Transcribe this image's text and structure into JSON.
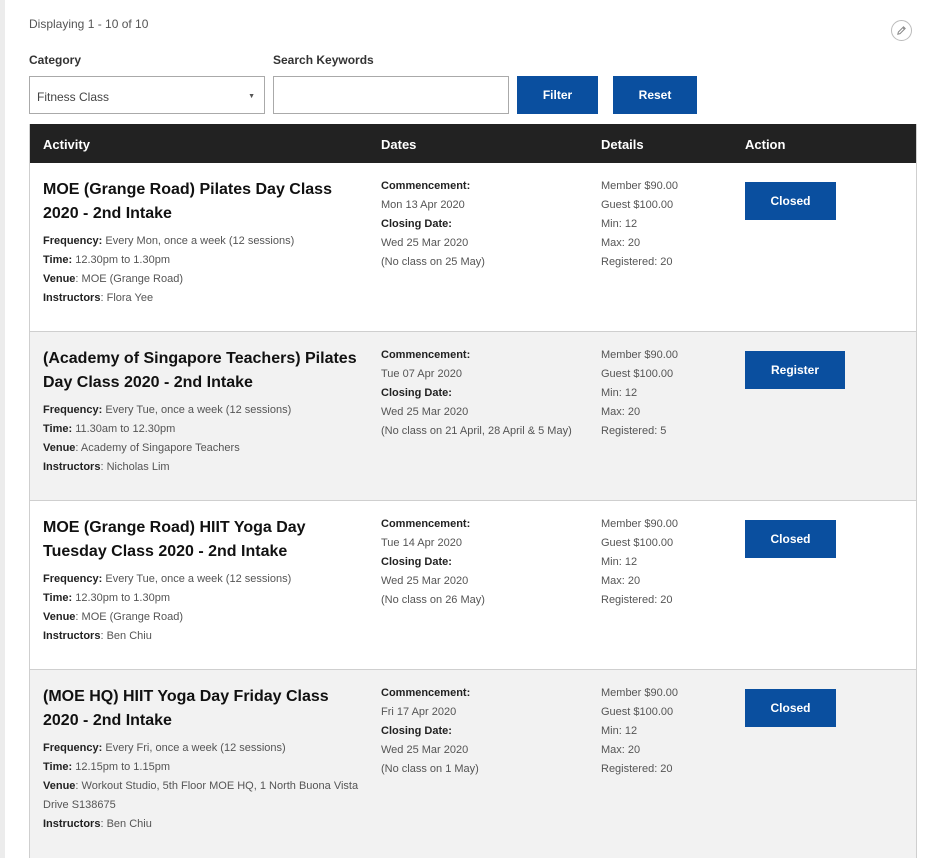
{
  "summary": "Displaying 1 - 10 of 10",
  "filters": {
    "category_label": "Category",
    "category_value": "Fitness Class",
    "keywords_label": "Search Keywords",
    "keywords_value": "",
    "filter_label": "Filter",
    "reset_label": "Reset"
  },
  "table": {
    "headers": [
      "Activity",
      "Dates",
      "Details",
      "Action"
    ],
    "field_labels": {
      "frequency": "Frequency:",
      "time": "Time:",
      "venue": "Venue",
      "instructors": "Instructors",
      "commencement": "Commencement:",
      "closing": "Closing Date:"
    },
    "rows": [
      {
        "title": "MOE (Grange Road) Pilates Day Class 2020 - 2nd Intake",
        "frequency": "Every Mon, once a week (12 sessions)",
        "time": "12.30pm to 1.30pm",
        "venue": "MOE (Grange Road)",
        "instructors": "Flora Yee",
        "commencement": "Mon 13 Apr 2020",
        "closing": "Wed 25 Mar 2020",
        "note": "(No class on 25 May)",
        "member": "Member $90.00",
        "guest": "Guest $100.00",
        "min": "Min: 12",
        "max": "Max: 20",
        "registered": "Registered: 20",
        "action": "Closed"
      },
      {
        "title": "(Academy of Singapore Teachers) Pilates Day Class 2020 - 2nd Intake",
        "frequency": "Every Tue, once a week (12 sessions)",
        "time": "11.30am to 12.30pm",
        "venue": "Academy of Singapore Teachers",
        "instructors": "Nicholas Lim",
        "commencement": "Tue 07 Apr 2020",
        "closing": "Wed 25 Mar 2020",
        "note": "(No class on 21 April, 28 April & 5 May)",
        "member": "Member $90.00",
        "guest": "Guest $100.00",
        "min": "Min: 12",
        "max": "Max: 20",
        "registered": "Registered: 5",
        "action": "Register"
      },
      {
        "title": "MOE (Grange Road) HIIT Yoga Day Tuesday Class 2020 - 2nd Intake",
        "frequency": "Every Tue, once a week (12 sessions)",
        "time": "12.30pm to 1.30pm",
        "venue": "MOE (Grange Road)",
        "instructors": "Ben Chiu",
        "commencement": "Tue 14 Apr 2020",
        "closing": "Wed 25 Mar 2020",
        "note": "(No class on 26 May)",
        "member": "Member $90.00",
        "guest": "Guest $100.00",
        "min": "Min: 12",
        "max": "Max: 20",
        "registered": "Registered: 20",
        "action": "Closed"
      },
      {
        "title": "(MOE HQ) HIIT Yoga Day Friday Class 2020 - 2nd Intake",
        "frequency": "Every Fri, once a week (12 sessions)",
        "time": "12.15pm to 1.15pm",
        "venue": "Workout Studio, 5th Floor MOE HQ, 1 North Buona Vista Drive S138675",
        "instructors": "Ben Chiu",
        "commencement": "Fri 17 Apr 2020",
        "closing": "Wed 25 Mar 2020",
        "note": "(No class on 1 May)",
        "member": "Member $90.00",
        "guest": "Guest $100.00",
        "min": "Min: 12",
        "max": "Max: 20",
        "registered": "Registered: 20",
        "action": "Closed"
      }
    ]
  },
  "icons": {
    "edit": "pencil-icon",
    "dropdown": "caret-down-icon"
  },
  "colors": {
    "primary": "#0a4f9f",
    "header_bg": "#222222",
    "alt_row": "#f2f2f2"
  }
}
